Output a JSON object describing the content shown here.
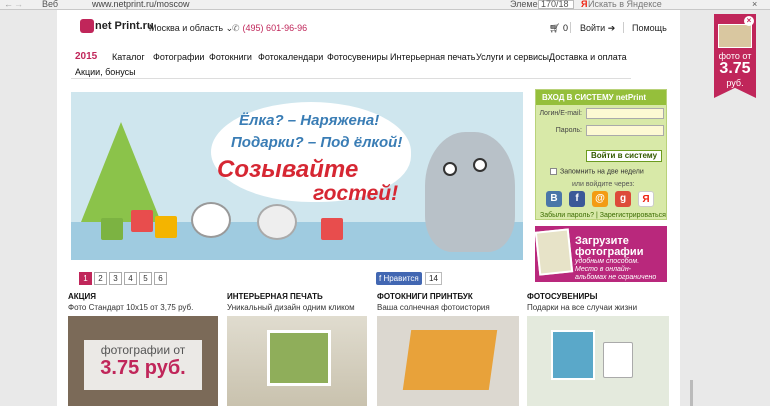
{
  "browser": {
    "back": "←",
    "forward": "→",
    "tab": "Веб",
    "url": "www.netprint.ru/moscow",
    "find_label": "Элементы:",
    "find_value": "170/18",
    "search_logo": "Я",
    "search_placeholder": "Искать в Яндексе",
    "close": "×"
  },
  "header": {
    "logo_text": "net Print.ru",
    "region": "Москва и область ⌄",
    "phone": "(495) 601-96-96",
    "cart": "0",
    "login": "Войти",
    "help": "Помощь"
  },
  "nav": {
    "year": "2015",
    "items": [
      "Каталог",
      "Фотографии",
      "Фотокниги",
      "Фотокалендари",
      "Фотосувениры",
      "Интерьерная печать",
      "Услуги и сервисы",
      "Доставка и оплата"
    ],
    "second_row": "Акции, бонусы"
  },
  "banner": {
    "line1": "Ёлка? – Наряжена!",
    "line2": "Подарки? – Под ёлкой!",
    "line3": "Созывайте",
    "line4": "гостей!"
  },
  "slides": [
    "1",
    "2",
    "3",
    "4",
    "5",
    "6"
  ],
  "social_like": {
    "label": "Нравится",
    "count": "14"
  },
  "login_box": {
    "title": "ВХОД В СИСТЕМУ netPrint",
    "login_label": "Логин/E-mail:",
    "password_label": "Пароль:",
    "submit": "Войти в систему",
    "remember": "Запомнить на две недели",
    "or_via": "или войдите через:",
    "social": [
      "В",
      "f",
      "@",
      "g",
      "Я"
    ],
    "forgot": "Забыли пароль?",
    "register": "Зарегистрироваться"
  },
  "upload_promo": {
    "title1": "Загрузите",
    "title2": "фотографии",
    "line1": "удобным способом.",
    "line2": "Место в онлайн-",
    "line3": "альбомах не ограничено"
  },
  "promo_tag": {
    "line1": "фото от",
    "price": "3.75",
    "line3": "руб."
  },
  "tiles": [
    {
      "title": "АКЦИЯ",
      "subtitle": "Фото Стандарт 10х15 от 3,75 руб.",
      "overlay": "фотографии от",
      "price": "3.75 руб."
    },
    {
      "title": "ИНТЕРЬЕРНАЯ ПЕЧАТЬ",
      "subtitle": "Уникальный дизайн одним кликом"
    },
    {
      "title": "ФОТОКНИГИ ПРИНТБУК",
      "subtitle": "Ваша солнечная фотоистория"
    },
    {
      "title": "ФОТОСУВЕНИРЫ",
      "subtitle": "Подарки на все случаи жизни"
    }
  ]
}
